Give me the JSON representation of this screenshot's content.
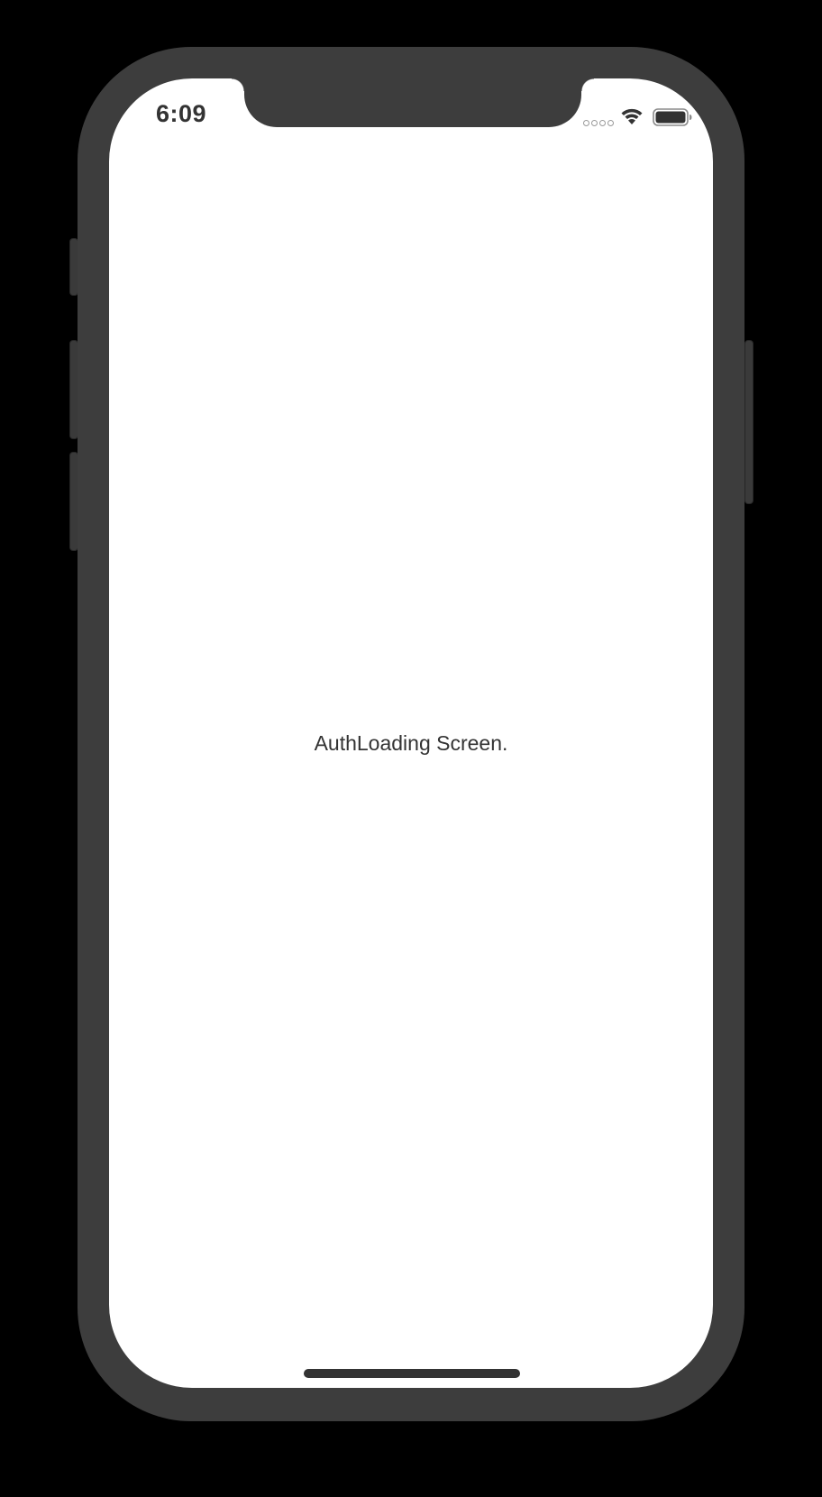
{
  "status_bar": {
    "time": "6:09",
    "signal_icon": "cellular-signal-dots-icon",
    "wifi_icon": "wifi-icon",
    "battery_icon": "battery-icon",
    "battery_level": 1.0
  },
  "main": {
    "label": "AuthLoading Screen."
  },
  "colors": {
    "frame": "#3d3d3d",
    "screen_background": "#ffffff",
    "text": "#333333"
  }
}
